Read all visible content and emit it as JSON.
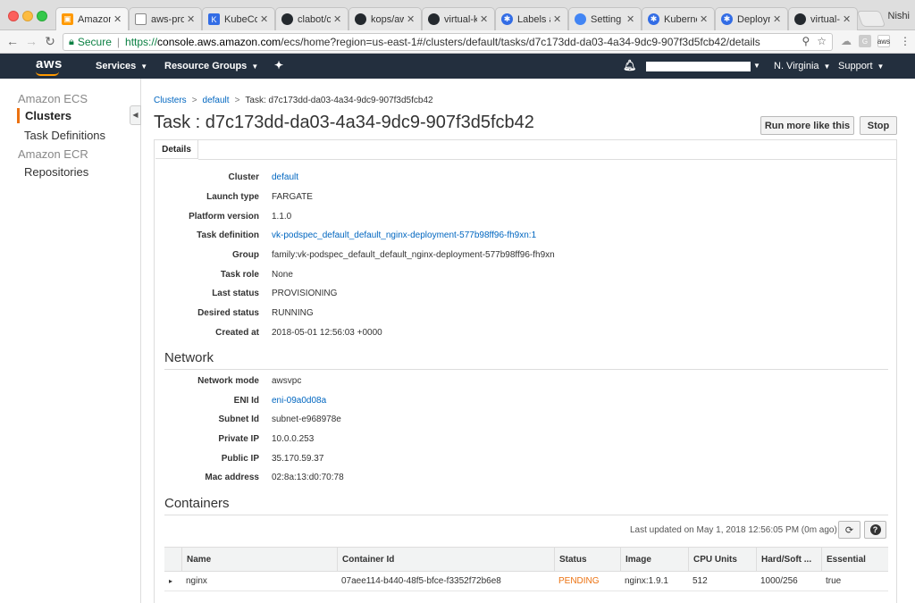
{
  "browser": {
    "tabs": [
      {
        "title": "Amazon",
        "icon": "aws-favicon",
        "color": "#f90"
      },
      {
        "title": "aws-proj",
        "icon": "document-favicon",
        "color": "#888"
      },
      {
        "title": "KubeCon",
        "icon": "kubecon-favicon",
        "color": "#326ce5"
      },
      {
        "title": "clabot/cl",
        "icon": "github-favicon",
        "color": "#24292e"
      },
      {
        "title": "kops/aws",
        "icon": "github-favicon",
        "color": "#24292e"
      },
      {
        "title": "virtual-k",
        "icon": "github-favicon",
        "color": "#24292e"
      },
      {
        "title": "Labels ar",
        "icon": "kubernetes-favicon",
        "color": "#326ce5"
      },
      {
        "title": "Setting u",
        "icon": "google-cloud-favicon",
        "color": "#4285f4"
      },
      {
        "title": "Kubernet",
        "icon": "kubernetes-favicon",
        "color": "#326ce5"
      },
      {
        "title": "Deploym",
        "icon": "kubernetes-favicon",
        "color": "#326ce5"
      },
      {
        "title": "virtual-k",
        "icon": "github-favicon",
        "color": "#24292e"
      }
    ],
    "profile": "Nishi",
    "secure_label": "Secure",
    "url_scheme": "https://",
    "url_domain": "console.aws.amazon.com",
    "url_path": "/ecs/home?region=us-east-1#/clusters/default/tasks/d7c173dd-da03-4a34-9dc9-907f3d5fcb42/details"
  },
  "awsnav": {
    "logo": "aws",
    "services": "Services",
    "resource_groups": "Resource Groups",
    "region": "N. Virginia",
    "support": "Support"
  },
  "sidebar": {
    "ecs_section": "Amazon ECS",
    "clusters": "Clusters",
    "task_definitions": "Task Definitions",
    "ecr_section": "Amazon ECR",
    "repositories": "Repositories"
  },
  "breadcrumb": {
    "clusters": "Clusters",
    "cluster": "default",
    "current": "Task: d7c173dd-da03-4a34-9dc9-907f3d5fcb42"
  },
  "page": {
    "title": "Task : d7c173dd-da03-4a34-9dc9-907f3d5fcb42",
    "run_more": "Run more like this",
    "stop": "Stop",
    "tab_details": "Details"
  },
  "details": [
    {
      "label": "Cluster",
      "value": "default",
      "link": true
    },
    {
      "label": "Launch type",
      "value": "FARGATE",
      "link": false
    },
    {
      "label": "Platform version",
      "value": "1.1.0",
      "link": false
    },
    {
      "label": "Task definition",
      "value": "vk-podspec_default_default_nginx-deployment-577b98ff96-fh9xn:1",
      "link": true
    },
    {
      "label": "Group",
      "value": "family:vk-podspec_default_default_nginx-deployment-577b98ff96-fh9xn",
      "link": false
    },
    {
      "label": "Task role",
      "value": "None",
      "link": false
    },
    {
      "label": "Last status",
      "value": "PROVISIONING",
      "link": false
    },
    {
      "label": "Desired status",
      "value": "RUNNING",
      "link": false
    },
    {
      "label": "Created at",
      "value": "2018-05-01 12:56:03 +0000",
      "link": false
    }
  ],
  "network": {
    "heading": "Network",
    "rows": [
      {
        "label": "Network mode",
        "value": "awsvpc",
        "link": false
      },
      {
        "label": "ENI Id",
        "value": "eni-09a0d08a",
        "link": true
      },
      {
        "label": "Subnet Id",
        "value": "subnet-e968978e",
        "link": false
      },
      {
        "label": "Private IP",
        "value": "10.0.0.253",
        "link": false
      },
      {
        "label": "Public IP",
        "value": "35.170.59.37",
        "link": false
      },
      {
        "label": "Mac address",
        "value": "02:8a:13:d0:70:78",
        "link": false
      }
    ]
  },
  "containers": {
    "heading": "Containers",
    "last_updated": "Last updated on May 1, 2018 12:56:05 PM (0m ago)",
    "columns": [
      "Name",
      "Container Id",
      "Status",
      "Image",
      "CPU Units",
      "Hard/Soft ...",
      "Essential"
    ],
    "rows": [
      {
        "expand": "▸",
        "name": "nginx",
        "container_id": "07aee114-b440-48f5-bfce-f3352f72b6e8",
        "status": "PENDING",
        "image": "nginx:1.9.1",
        "cpu": "512",
        "memory": "1000/256",
        "essential": "true"
      }
    ]
  },
  "colors": {
    "aws_nav": "#232f3e",
    "accent_orange": "#ec7211",
    "link_blue": "#0066c0"
  }
}
